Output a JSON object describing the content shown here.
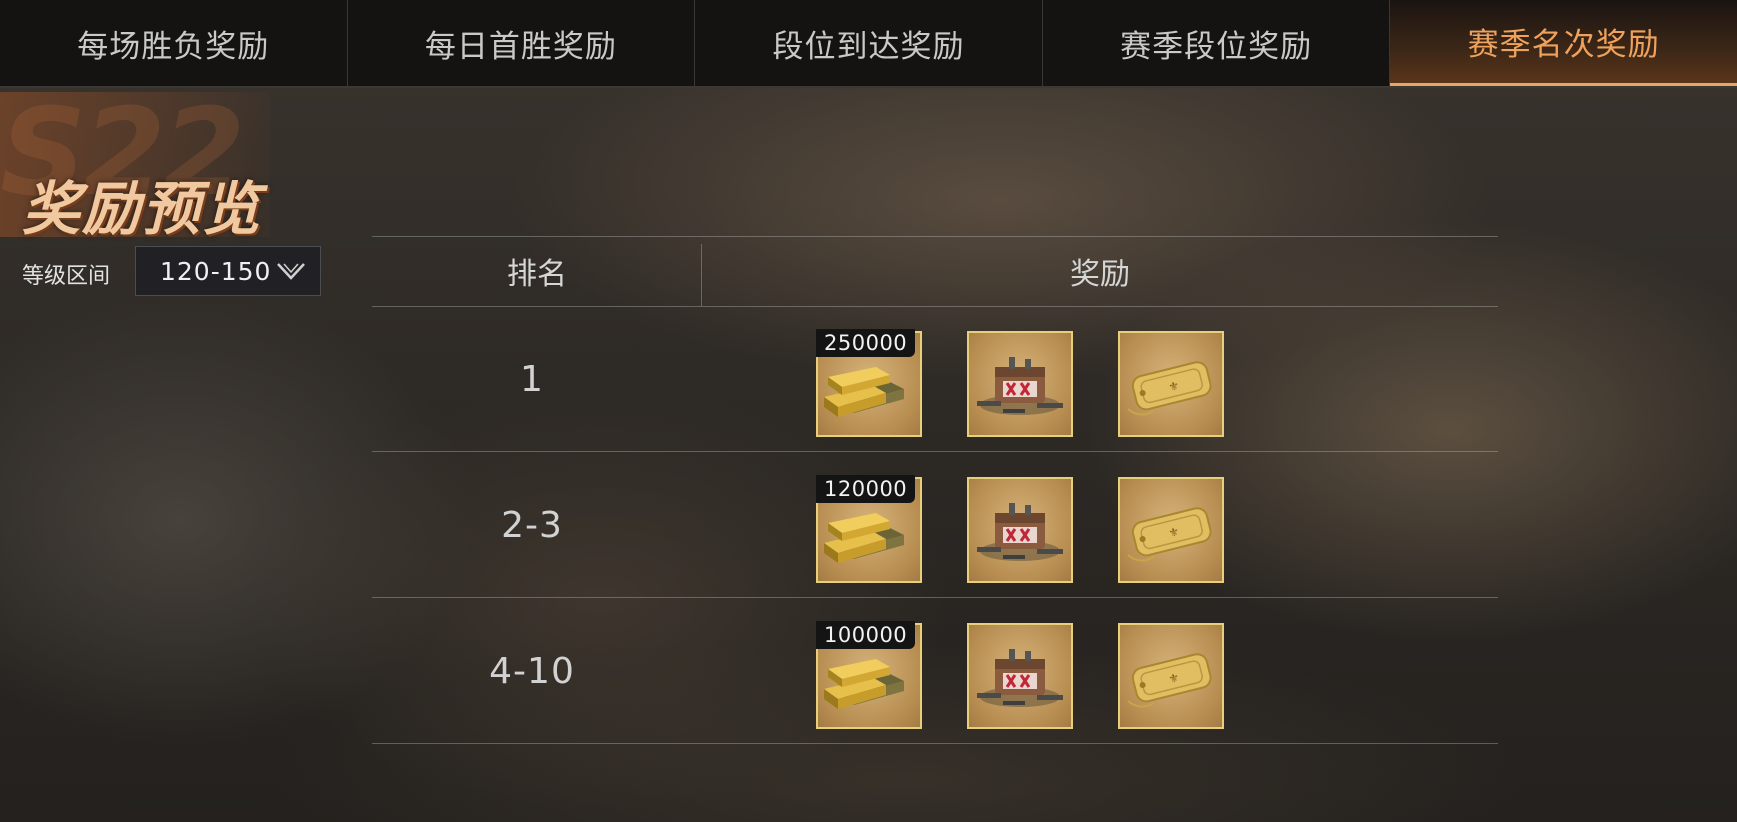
{
  "tabs": [
    {
      "label": "每场胜负奖励"
    },
    {
      "label": "每日首胜奖励"
    },
    {
      "label": "段位到达奖励"
    },
    {
      "label": "赛季段位奖励"
    },
    {
      "label": "赛季名次奖励"
    }
  ],
  "active_tab": "赛季名次奖励",
  "season_mark": "S22",
  "heading": "奖励预览",
  "filter": {
    "label": "等级区间",
    "value": "120-150"
  },
  "table": {
    "col_rank": "排名",
    "col_reward": "奖励",
    "rows": [
      {
        "rank": "1",
        "gold_amount": "250000",
        "items": [
          "gold-bars-icon",
          "supply-crate-icon",
          "dog-tag-icon"
        ]
      },
      {
        "rank": "2-3",
        "gold_amount": "120000",
        "items": [
          "gold-bars-icon",
          "supply-crate-icon",
          "dog-tag-icon"
        ]
      },
      {
        "rank": "4-10",
        "gold_amount": "100000",
        "items": [
          "gold-bars-icon",
          "supply-crate-icon",
          "dog-tag-icon"
        ]
      }
    ]
  },
  "colors": {
    "accent": "#f0a25c",
    "item_border": "#e8cf7a",
    "item_bg": "#c9a066"
  }
}
